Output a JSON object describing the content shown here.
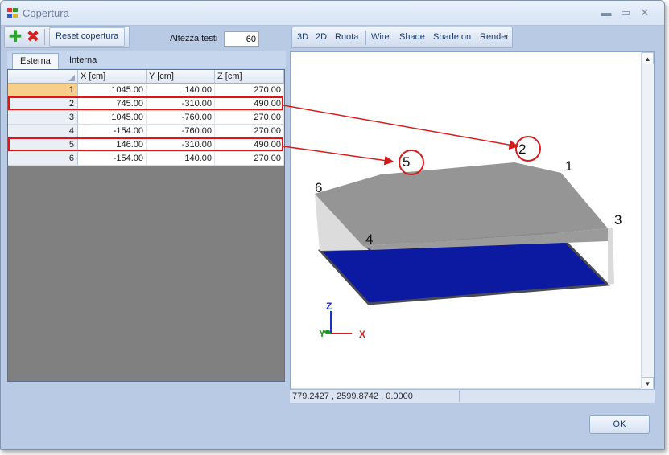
{
  "window": {
    "title": "Copertura",
    "minimize": "▬",
    "maximize": "▭",
    "close": "✕"
  },
  "toolbar": {
    "add_icon": "plus-icon",
    "delete_icon": "delete-icon",
    "reset_label": "Reset copertura",
    "text_height_label": "Altezza testi",
    "text_height_value": "60"
  },
  "view_toolbar": {
    "btn_3d": "3D",
    "btn_2d": "2D",
    "btn_ruota": "Ruota",
    "btn_wire": "Wire",
    "btn_shade": "Shade",
    "btn_shade_on": "Shade on",
    "btn_render": "Render"
  },
  "tabs": [
    {
      "label": "Esterna",
      "active": true
    },
    {
      "label": "Interna",
      "active": false
    }
  ],
  "grid": {
    "columns": [
      "X [cm]",
      "Y [cm]",
      "Z [cm]"
    ],
    "rows": [
      {
        "n": "1",
        "x": "1045.00",
        "y": "140.00",
        "z": "270.00"
      },
      {
        "n": "2",
        "x": "745.00",
        "y": "-310.00",
        "z": "490.00"
      },
      {
        "n": "3",
        "x": "1045.00",
        "y": "-760.00",
        "z": "270.00"
      },
      {
        "n": "4",
        "x": "-154.00",
        "y": "-760.00",
        "z": "270.00"
      },
      {
        "n": "5",
        "x": "146.00",
        "y": "-310.00",
        "z": "490.00"
      },
      {
        "n": "6",
        "x": "-154.00",
        "y": "140.00",
        "z": "270.00"
      }
    ],
    "highlighted_rows": [
      "2",
      "5"
    ]
  },
  "viewport": {
    "vertex_labels": [
      "1",
      "2",
      "3",
      "4",
      "5",
      "6"
    ],
    "axis_labels": {
      "z": "Z",
      "y": "Y",
      "x": "X"
    },
    "colors": {
      "roof": "#8f8f8f",
      "floor": "#0a1a9c",
      "callout": "#d41c1c"
    }
  },
  "status_bar": {
    "coordinates": "779.2427 , 2599.8742 , 0.0000"
  },
  "ok_label": "OK"
}
